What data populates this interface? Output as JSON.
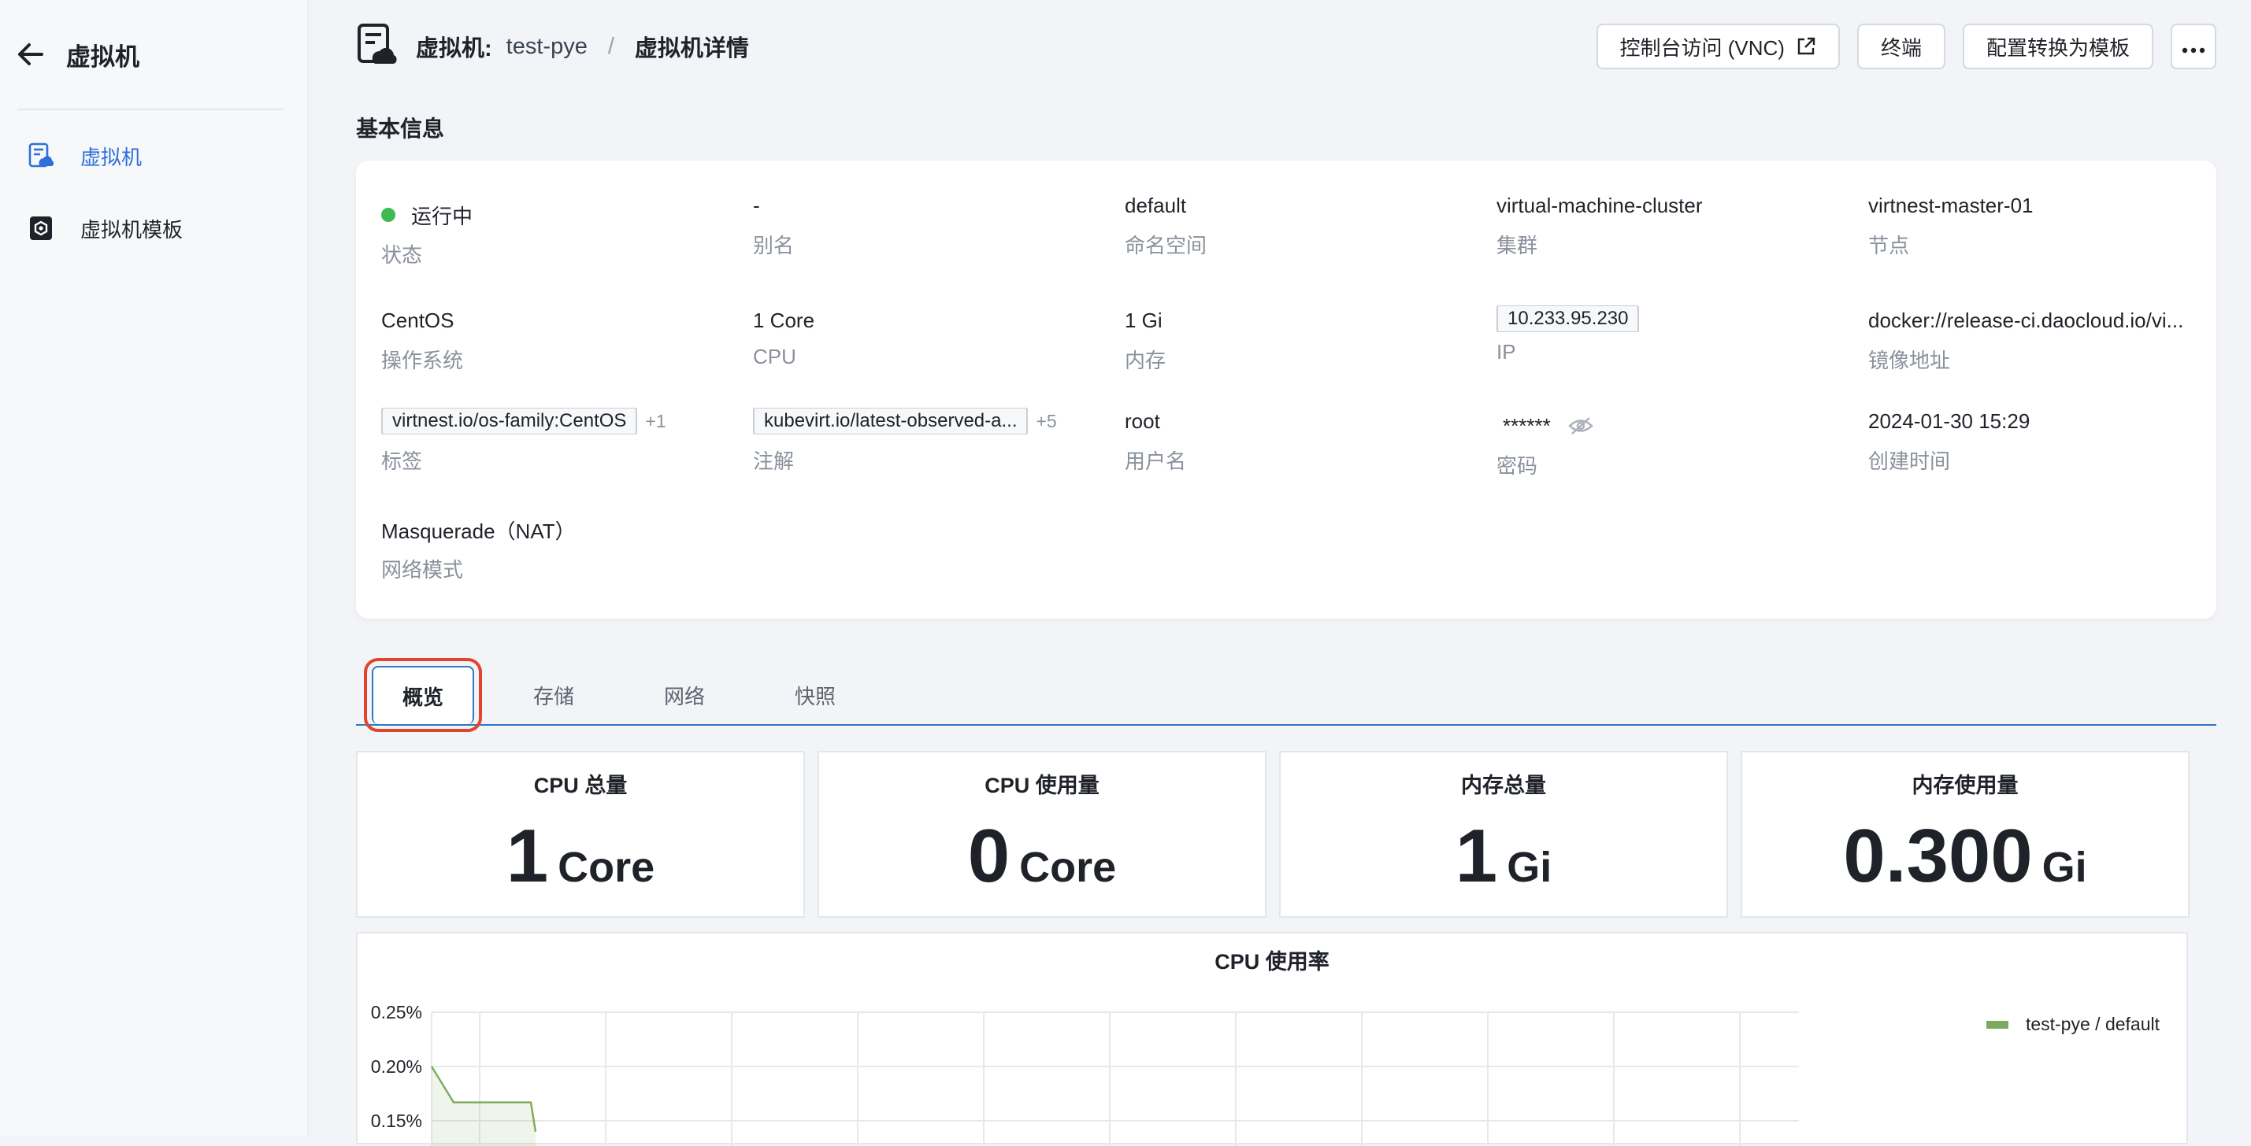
{
  "sidebar": {
    "title": "虚拟机",
    "items": [
      {
        "label": "虚拟机",
        "icon": "vm-cloud-icon",
        "active": true
      },
      {
        "label": "虚拟机模板",
        "icon": "vm-template-icon",
        "active": false
      }
    ]
  },
  "header": {
    "breadcrumb_prefix": "虚拟机:",
    "vm_name": "test-pye",
    "separator": "/",
    "page": "虚拟机详情",
    "actions": {
      "vnc": "控制台访问 (VNC)",
      "terminal": "终端",
      "to_template": "配置转换为模板"
    }
  },
  "basic_info": {
    "title": "基本信息",
    "fields": {
      "status": {
        "value": "运行中",
        "label": "状态"
      },
      "alias": {
        "value": "-",
        "label": "别名"
      },
      "namespace": {
        "value": "default",
        "label": "命名空间"
      },
      "cluster": {
        "value": "virtual-machine-cluster",
        "label": "集群"
      },
      "node": {
        "value": "virtnest-master-01",
        "label": "节点"
      },
      "os": {
        "value": "CentOS",
        "label": "操作系统"
      },
      "cpu": {
        "value": "1 Core",
        "label": "CPU"
      },
      "memory": {
        "value": "1 Gi",
        "label": "内存"
      },
      "ip": {
        "value": "10.233.95.230",
        "label": "IP"
      },
      "image": {
        "value": "docker://release-ci.daocloud.io/vi...",
        "label": "镜像地址"
      },
      "labels": {
        "value": "virtnest.io/os-family:CentOS",
        "more": "+1",
        "label": "标签"
      },
      "annotations": {
        "value": "kubevirt.io/latest-observed-a...",
        "more": "+5",
        "label": "注解"
      },
      "username": {
        "value": "root",
        "label": "用户名"
      },
      "password": {
        "value": "******",
        "label": "密码"
      },
      "created": {
        "value": "2024-01-30 15:29",
        "label": "创建时间"
      },
      "network_mode": {
        "value": "Masquerade（NAT）",
        "label": "网络模式"
      }
    }
  },
  "tabs": [
    "概览",
    "存储",
    "网络",
    "快照"
  ],
  "stats": [
    {
      "title": "CPU 总量",
      "value": "1",
      "unit": "Core"
    },
    {
      "title": "CPU 使用量",
      "value": "0",
      "unit": "Core"
    },
    {
      "title": "内存总量",
      "value": "1",
      "unit": "Gi"
    },
    {
      "title": "内存使用量",
      "value": "0.300",
      "unit": "Gi"
    }
  ],
  "colors": {
    "accent": "#2f78c4",
    "status_running": "#3fb950",
    "highlight": "#e0442d",
    "series": "#7caa5c"
  },
  "chart_data": {
    "type": "area",
    "title": "CPU 使用率",
    "y_tick_labels": [
      "0.25%",
      "0.20%",
      "0.15%"
    ],
    "ylim": [
      0.15,
      0.25
    ],
    "grid": true,
    "legend_position": "top-right",
    "series": [
      {
        "name": "test-pye / default",
        "values": [
          0.2,
          0.167,
          0.167,
          0.167,
          0.14
        ]
      }
    ]
  }
}
